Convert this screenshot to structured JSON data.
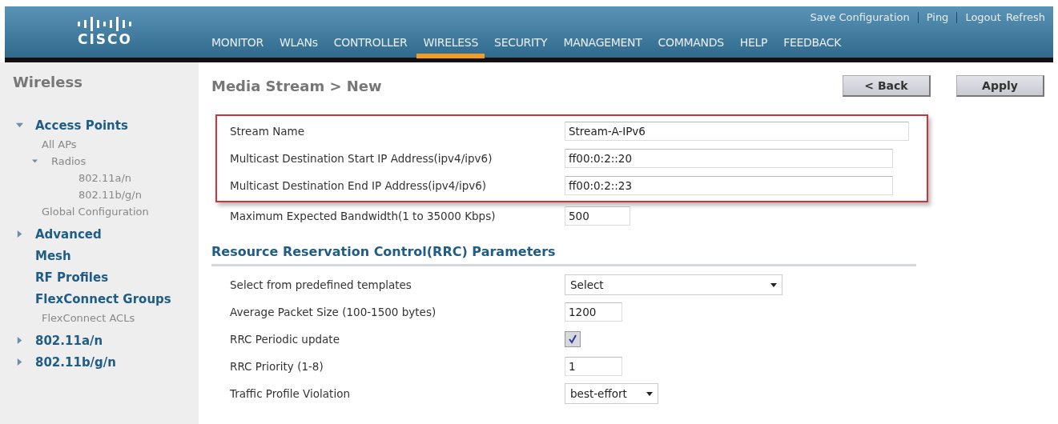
{
  "header": {
    "logo": "CISCO",
    "top_links": [
      "Save Configuration",
      "Ping",
      "Logout",
      "Refresh"
    ],
    "menu": [
      {
        "label": "MONITOR",
        "selected": false
      },
      {
        "label": "WLANs",
        "selected": false
      },
      {
        "label": "CONTROLLER",
        "selected": false
      },
      {
        "label": "WIRELESS",
        "selected": true
      },
      {
        "label": "SECURITY",
        "selected": false
      },
      {
        "label": "MANAGEMENT",
        "selected": false
      },
      {
        "label": "COMMANDS",
        "selected": false
      },
      {
        "label": "HELP",
        "selected": false
      },
      {
        "label": "FEEDBACK",
        "selected": false
      }
    ]
  },
  "sidebar": {
    "title": "Wireless",
    "items": [
      {
        "label": "Access Points",
        "expanded": true,
        "children": [
          {
            "label": "All APs"
          },
          {
            "label": "Radios",
            "expanded": true,
            "children": [
              {
                "label": "802.11a/n"
              },
              {
                "label": "802.11b/g/n"
              }
            ]
          },
          {
            "label": "Global Configuration"
          }
        ]
      },
      {
        "label": "Advanced",
        "expanded": false
      },
      {
        "label": "Mesh"
      },
      {
        "label": "RF Profiles"
      },
      {
        "label": "FlexConnect Groups",
        "children": [
          {
            "label": "FlexConnect ACLs"
          }
        ]
      },
      {
        "label": "802.11a/n",
        "expanded": false
      },
      {
        "label": "802.11b/g/n",
        "expanded": false
      }
    ]
  },
  "page": {
    "title": "Media Stream > New",
    "buttons": [
      "< Back",
      "Apply"
    ],
    "fields": [
      {
        "label": "Stream Name",
        "kind": "text",
        "value": "Stream-A-IPv6",
        "highlighted": true
      },
      {
        "label": "Multicast Destination Start IP Address(ipv4/ipv6)",
        "kind": "text",
        "value": "ff00:0:2::20",
        "highlighted": true
      },
      {
        "label": "Multicast Destination End IP Address(ipv4/ipv6)",
        "kind": "text",
        "value": "ff00:0:2::23",
        "highlighted": true
      },
      {
        "label": "Maximum Expected Bandwidth(1 to 35000 Kbps)",
        "kind": "text",
        "value": "500",
        "highlighted": false
      }
    ],
    "section": {
      "title": "Resource Reservation Control(RRC) Parameters",
      "fields": [
        {
          "label": "Select from predefined templates",
          "kind": "select",
          "value": "Select"
        },
        {
          "label": "Average Packet Size (100-1500 bytes)",
          "kind": "text",
          "value": "1200"
        },
        {
          "label": "RRC Periodic update",
          "kind": "checkbox",
          "checked": true
        },
        {
          "label": "RRC Priority (1-8)",
          "kind": "text",
          "value": "1"
        },
        {
          "label": "Traffic Profile Violation",
          "kind": "select",
          "value": "best-effort"
        }
      ]
    }
  }
}
